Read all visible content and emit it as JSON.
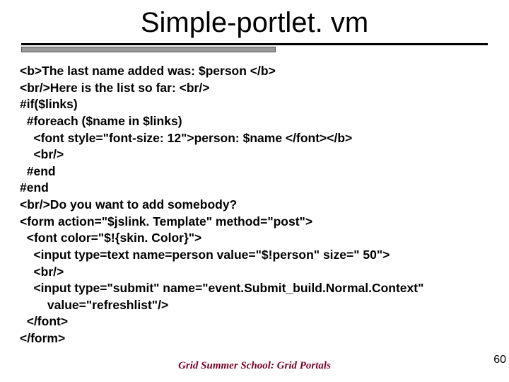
{
  "title": "Simple-portlet. vm",
  "code_lines": [
    "<b>The last name added was: $person </b>",
    "<br/>Here is the list so far: <br/>",
    "#if($links)",
    "  #foreach ($name in $links)",
    "    <font style=\"font-size: 12\">person: $name </font></b>",
    "    <br/>",
    "  #end",
    "#end",
    "<br/>Do you want to add somebody?",
    "<form action=\"$jslink. Template\" method=\"post\">",
    "  <font color=\"$!{skin. Color}\">",
    "    <input type=text name=person value=\"$!person\" size=\" 50\">",
    "    <br/>",
    "    <input type=\"submit\" name=\"event.Submit_build.Normal.Context\"",
    "        value=\"refreshlist\"/>",
    "  </font>",
    "</form>"
  ],
  "footer": "Grid Summer School: Grid Portals",
  "page_number": "60"
}
